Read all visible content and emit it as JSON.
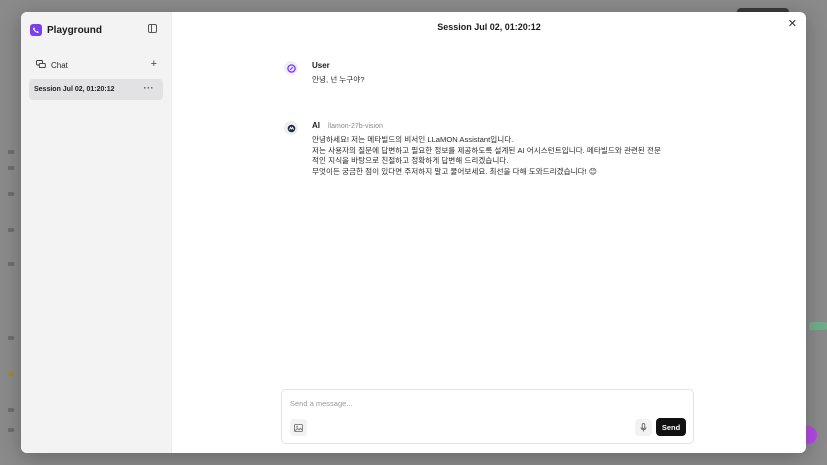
{
  "app": {
    "brand": "Playground"
  },
  "sidebar": {
    "chat_label": "Chat",
    "sessions": [
      {
        "label": "Session Jul 02, 01:20:12"
      }
    ]
  },
  "main": {
    "title": "Session Jul 02, 01:20:12"
  },
  "messages": [
    {
      "role": "User",
      "text": "안녕, 넌 누구야?"
    },
    {
      "role": "AI",
      "model": "llamon-27b-vision",
      "text": "안녕하세요! 저는 메타빌드의 비서인 LLaMON Assistant입니다.\n저는 사용자의 질문에 답변하고 필요한 정보를 제공하도록 설계된 AI 어시스턴트입니다. 메타빌드와 관련된 전문\n적인 지식을 바탕으로 친절하고 정확하게 답변해 드리겠습니다.\n무엇이든 궁금한 점이 있다면 주저하지 말고 물어보세요. 최선을 다해 도와드리겠습니다! 😊"
    }
  ],
  "composer": {
    "placeholder": "Send a message...",
    "value": "",
    "send_label": "Send"
  },
  "colors": {
    "brand": "#7b3ff2",
    "send_button": "#111111",
    "sidebar_bg": "#f3f3f4",
    "session_active_bg": "#e2e2e4"
  },
  "icons": {
    "brand": "phone-logo-icon",
    "collapse": "sidebar-toggle-icon",
    "chat": "chat-bubbles-icon",
    "new_chat": "plus-icon",
    "session_menu": "more-horizontal-icon",
    "close": "close-icon",
    "user_avatar": "user-avatar-icon",
    "ai_avatar": "ai-avatar-icon",
    "attach_image": "image-icon",
    "mic": "microphone-icon"
  }
}
